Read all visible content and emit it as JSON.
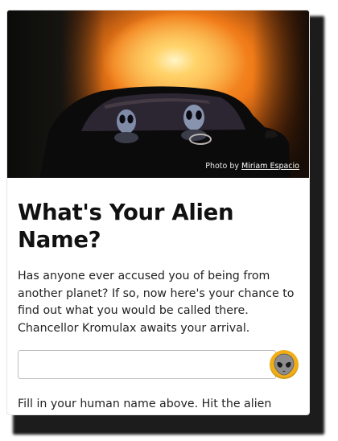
{
  "hero": {
    "credit_prefix": "Photo by ",
    "credit_author": "Miriam Espacio"
  },
  "main": {
    "title": "What's Your Alien Name?",
    "intro": "Has anyone ever accused you of being from another planet? If so, now here's your chance to find out what you would be called there. Chancellor Kromulax awaits your arrival.",
    "name_input": {
      "value": "",
      "placeholder": ""
    },
    "alien_button": {
      "icon": "alien-face-icon",
      "color": "#f0ad18"
    },
    "hint": "Fill in your human name above. Hit the alien button and learn your intergalactic moniker!"
  }
}
